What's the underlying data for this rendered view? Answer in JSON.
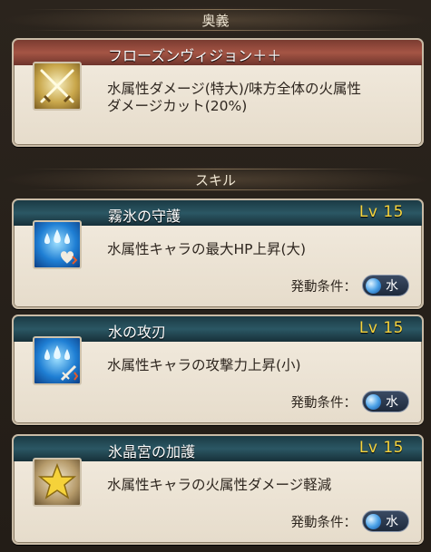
{
  "ougi": {
    "header": "奥義",
    "name": "フローズンヴィジョン＋＋",
    "description_line1": "水属性ダメージ(特大)/味方全体の火属性",
    "description_line2": "ダメージカット(20%)",
    "icon": "crossed-swords-icon"
  },
  "skills_header": "スキル",
  "condition_label": "発動条件：",
  "skills": [
    {
      "name": "霧氷の守護",
      "level": "Lv 15",
      "description": "水属性キャラの最大HP上昇(大)",
      "element": "水",
      "icon": "water-drops-heart-icon"
    },
    {
      "name": "水の攻刃",
      "level": "Lv 15",
      "description": "水属性キャラの攻撃力上昇(小)",
      "element": "水",
      "icon": "water-drops-sword-icon"
    },
    {
      "name": "氷晶宮の加護",
      "level": "Lv 15",
      "description": "水属性キャラの火属性ダメージ軽減",
      "element": "水",
      "icon": "gold-star-icon"
    }
  ],
  "colors": {
    "ougi_title_bar": "#a55545",
    "skill_title_bar": "#2b5764",
    "level_text": "#f6d43e",
    "water_element": "#4ea3e8"
  }
}
